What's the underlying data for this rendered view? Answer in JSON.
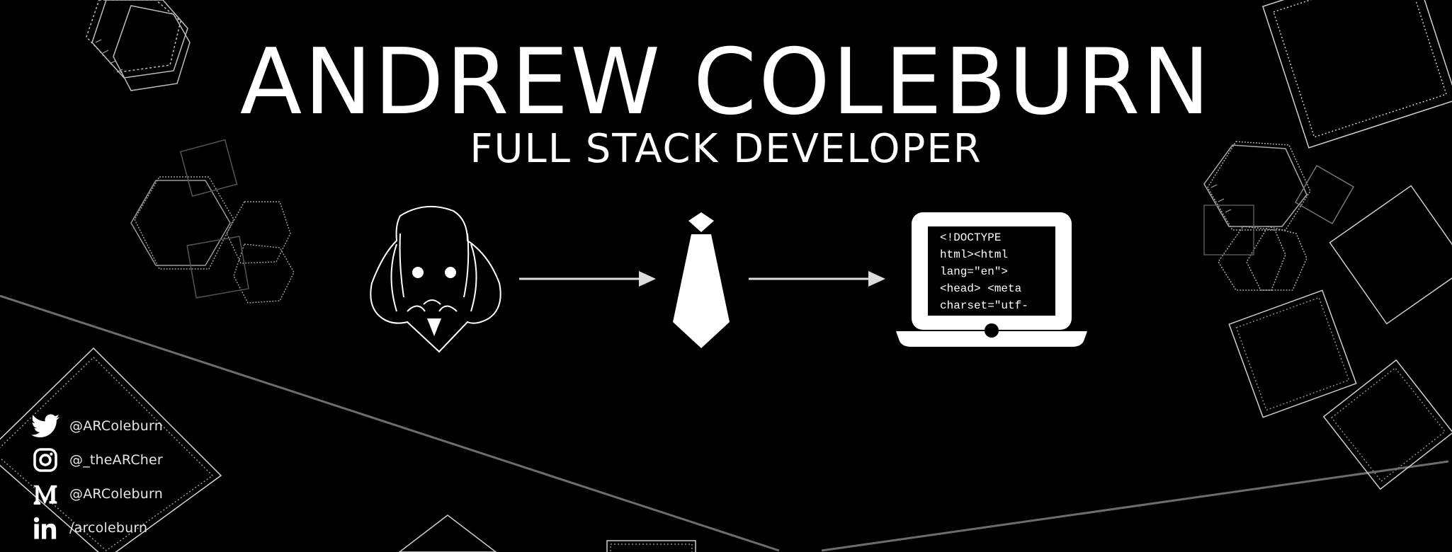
{
  "header": {
    "name": "ANDREW COLEBURN",
    "role": "FULL STACK DEVELOPER"
  },
  "journey": {
    "steps": [
      {
        "icon": "shakespeare-icon"
      },
      {
        "icon": "arrow-right-icon"
      },
      {
        "icon": "necktie-icon"
      },
      {
        "icon": "arrow-right-icon"
      },
      {
        "icon": "laptop-icon"
      }
    ],
    "laptop_code_lines": [
      "<!DOCTYPE",
      "html><html",
      "lang=\"en\">",
      "<head> <meta",
      "charset=\"utf-"
    ]
  },
  "social": {
    "items": [
      {
        "icon": "twitter-icon",
        "label": "@ARColeburn"
      },
      {
        "icon": "instagram-icon",
        "label": "@_theARCher"
      },
      {
        "icon": "medium-icon",
        "label": "@ARColeburn"
      },
      {
        "icon": "linkedin-icon",
        "label": "/arcoleburn"
      }
    ]
  },
  "colors": {
    "background": "#000000",
    "foreground": "#ffffff",
    "decoration": "#9a9a9a"
  }
}
